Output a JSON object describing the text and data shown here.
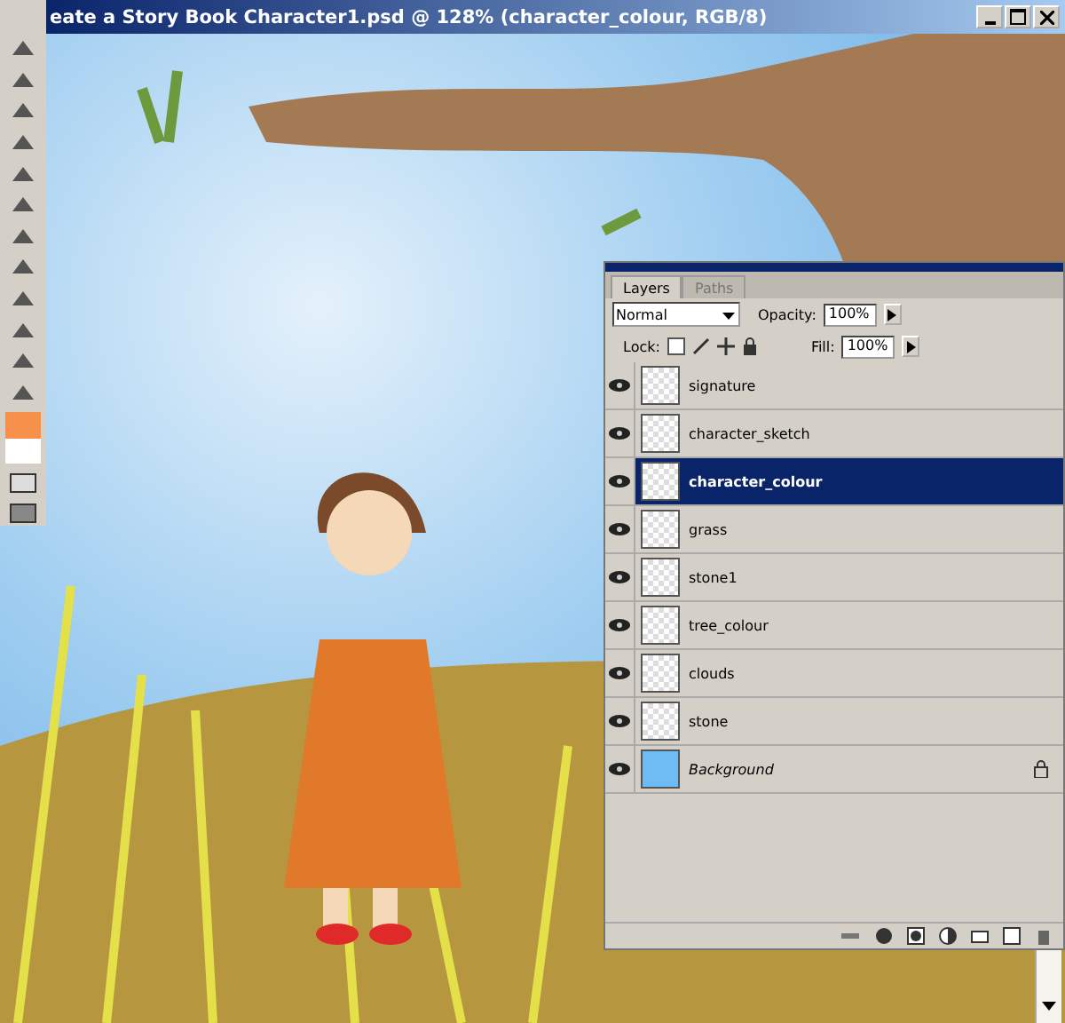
{
  "document_window": {
    "title": "eate a Story Book Character1.psd @ 128% (character_colour, RGB/8)"
  },
  "layers_palette": {
    "tabs": [
      {
        "label": "Layers",
        "selected": true
      },
      {
        "label": "Paths",
        "selected": false
      }
    ],
    "blend_mode": "Normal",
    "opacity_label": "Opacity:",
    "opacity": "100%",
    "lock_label": "Lock:",
    "fill_label": "Fill:",
    "fill": "100%",
    "layers": [
      {
        "name": "signature",
        "kind": "layer",
        "visible": true,
        "selected": false,
        "locked": false
      },
      {
        "name": "character_sketch",
        "kind": "layer",
        "visible": true,
        "selected": false,
        "locked": false
      },
      {
        "name": "character_colour",
        "kind": "layer",
        "visible": true,
        "selected": true,
        "locked": false
      },
      {
        "name": "grass",
        "kind": "layer",
        "visible": true,
        "selected": false,
        "locked": false
      },
      {
        "name": "stone1",
        "kind": "layer",
        "visible": true,
        "selected": false,
        "locked": false
      },
      {
        "name": "tree_colour",
        "kind": "layer",
        "visible": true,
        "selected": false,
        "locked": false
      },
      {
        "name": "clouds",
        "kind": "layer",
        "visible": true,
        "selected": false,
        "locked": false
      },
      {
        "name": "stone",
        "kind": "layer",
        "visible": true,
        "selected": false,
        "locked": false
      },
      {
        "name": "Background",
        "kind": "background",
        "visible": true,
        "selected": false,
        "locked": true
      }
    ]
  }
}
